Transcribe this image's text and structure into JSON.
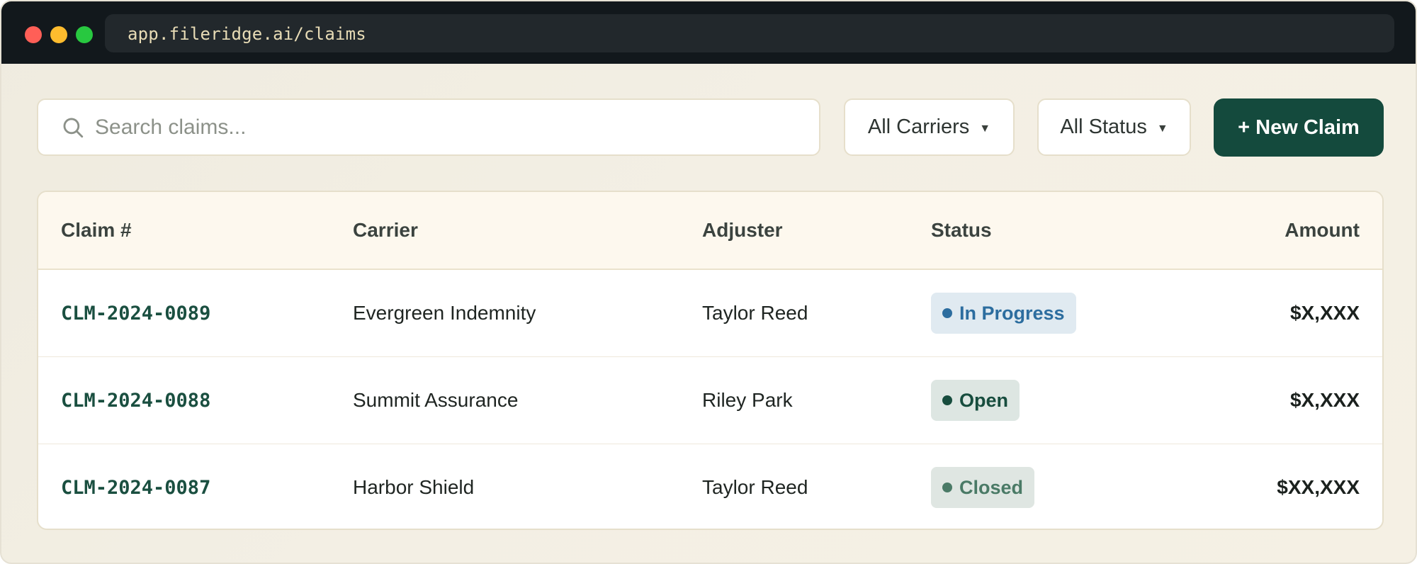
{
  "browser": {
    "url": "app.fileridge.ai/claims"
  },
  "toolbar": {
    "search_placeholder": "Search claims...",
    "carrier_filter": "All Carriers",
    "status_filter": "All Status",
    "new_claim_label": "+ New Claim"
  },
  "table": {
    "headers": {
      "claim": "Claim #",
      "carrier": "Carrier",
      "adjuster": "Adjuster",
      "status": "Status",
      "amount": "Amount"
    },
    "rows": [
      {
        "claim": "CLM-2024-0089",
        "carrier": "Evergreen Indemnity",
        "adjuster": "Taylor Reed",
        "status": "In Progress",
        "amount": "$X,XXX"
      },
      {
        "claim": "CLM-2024-0088",
        "carrier": "Summit Assurance",
        "adjuster": "Riley Park",
        "status": "Open",
        "amount": "$X,XXX"
      },
      {
        "claim": "CLM-2024-0087",
        "carrier": "Harbor Shield",
        "adjuster": "Taylor Reed",
        "status": "Closed",
        "amount": "$XX,XXX"
      }
    ]
  },
  "colors": {
    "brand": "#144a3d",
    "status_in_progress": "#2c6d9f",
    "status_open": "#174d3e",
    "status_closed": "#4a7a66"
  },
  "icons": {
    "search": "search-icon",
    "dropdown": "chevron-down-icon"
  }
}
